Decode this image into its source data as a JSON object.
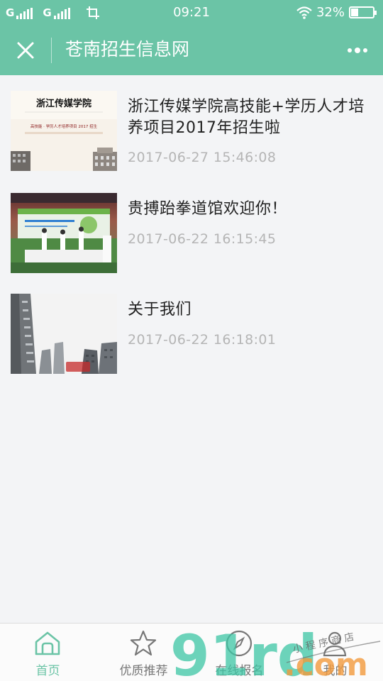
{
  "status_bar": {
    "signal1_label": "G",
    "signal2_label": "G",
    "time": "09:21",
    "battery_percent": "32%",
    "battery_level": 0.32
  },
  "header": {
    "title": "苍南招生信息网"
  },
  "articles": [
    {
      "title": "浙江传媒学院高技能+学历人才培养项目2017年招生啦",
      "time": "2017-06-27 15:46:08",
      "thumb_text_1": "浙江传媒学院",
      "thumb_text_2": "高技能 · 学历人才培养项目 2017 招生"
    },
    {
      "title": "贵搏跆拳道馆欢迎你！",
      "time": "2017-06-22 16:15:45"
    },
    {
      "title": "关于我们",
      "time": "2017-06-22 16:18:01"
    }
  ],
  "tabbar": {
    "tabs": [
      {
        "label": "首页",
        "icon": "home-icon",
        "active": true
      },
      {
        "label": "优质推荐",
        "icon": "star-icon",
        "active": false
      },
      {
        "label": "在线报名",
        "icon": "compass-icon",
        "active": false
      },
      {
        "label": "我的",
        "icon": "user-icon",
        "active": false
      }
    ]
  },
  "watermark": {
    "text": "91rd.com",
    "handwriting": "小程序商店"
  },
  "colors": {
    "brand": "#6bc4a6",
    "background": "#f3f4f6",
    "title_text": "#222222",
    "time_text": "#b5b5b5"
  }
}
